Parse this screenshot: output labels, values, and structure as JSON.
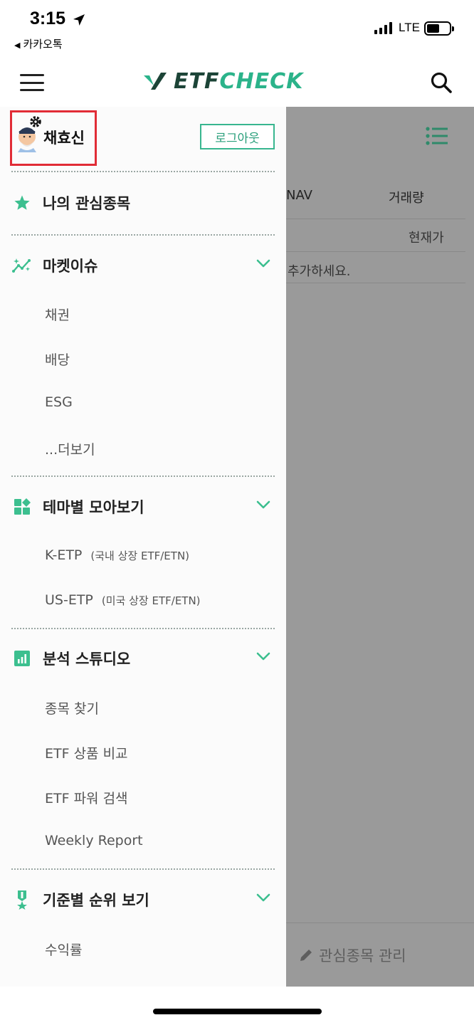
{
  "status_bar": {
    "time": "3:15",
    "back_app": "카카오톡",
    "network": "LTE",
    "battery_level": 0.55
  },
  "header": {
    "logo_etf": "ETF",
    "logo_check": "CHECK",
    "menu_icon": "hamburger-icon",
    "search_icon": "search-icon"
  },
  "drawer": {
    "user_name": "채효신",
    "logout_label": "로그아웃",
    "favorites_label": "나의 관심종목",
    "sections": {
      "market": {
        "title": "마켓이슈",
        "items": [
          "채권",
          "배당",
          "ESG",
          "...더보기"
        ]
      },
      "theme": {
        "title": "테마별 모아보기",
        "items": [
          {
            "label": "K-ETP",
            "note": "(국내 상장 ETF/ETN)"
          },
          {
            "label": "US-ETP",
            "note": "(미국 상장 ETF/ETN)"
          }
        ]
      },
      "studio": {
        "title": "분석 스튜디오",
        "items": [
          "종목 찾기",
          "ETF 상품 비교",
          "ETF 파워 검색",
          "Weekly Report"
        ]
      },
      "ranking": {
        "title": "기준별 순위 보기",
        "items": [
          "수익률"
        ]
      }
    }
  },
  "background": {
    "col_nav": "NAV",
    "col_volume": "거래량",
    "col_price": "현재가",
    "empty_text": "추가하세요.",
    "manage_label": "관심종목 관리"
  },
  "colors": {
    "accent": "#2bb38a",
    "brand_dark": "#1c4437",
    "highlight_box": "#e12c36",
    "overlay": "#9a9a9a"
  }
}
